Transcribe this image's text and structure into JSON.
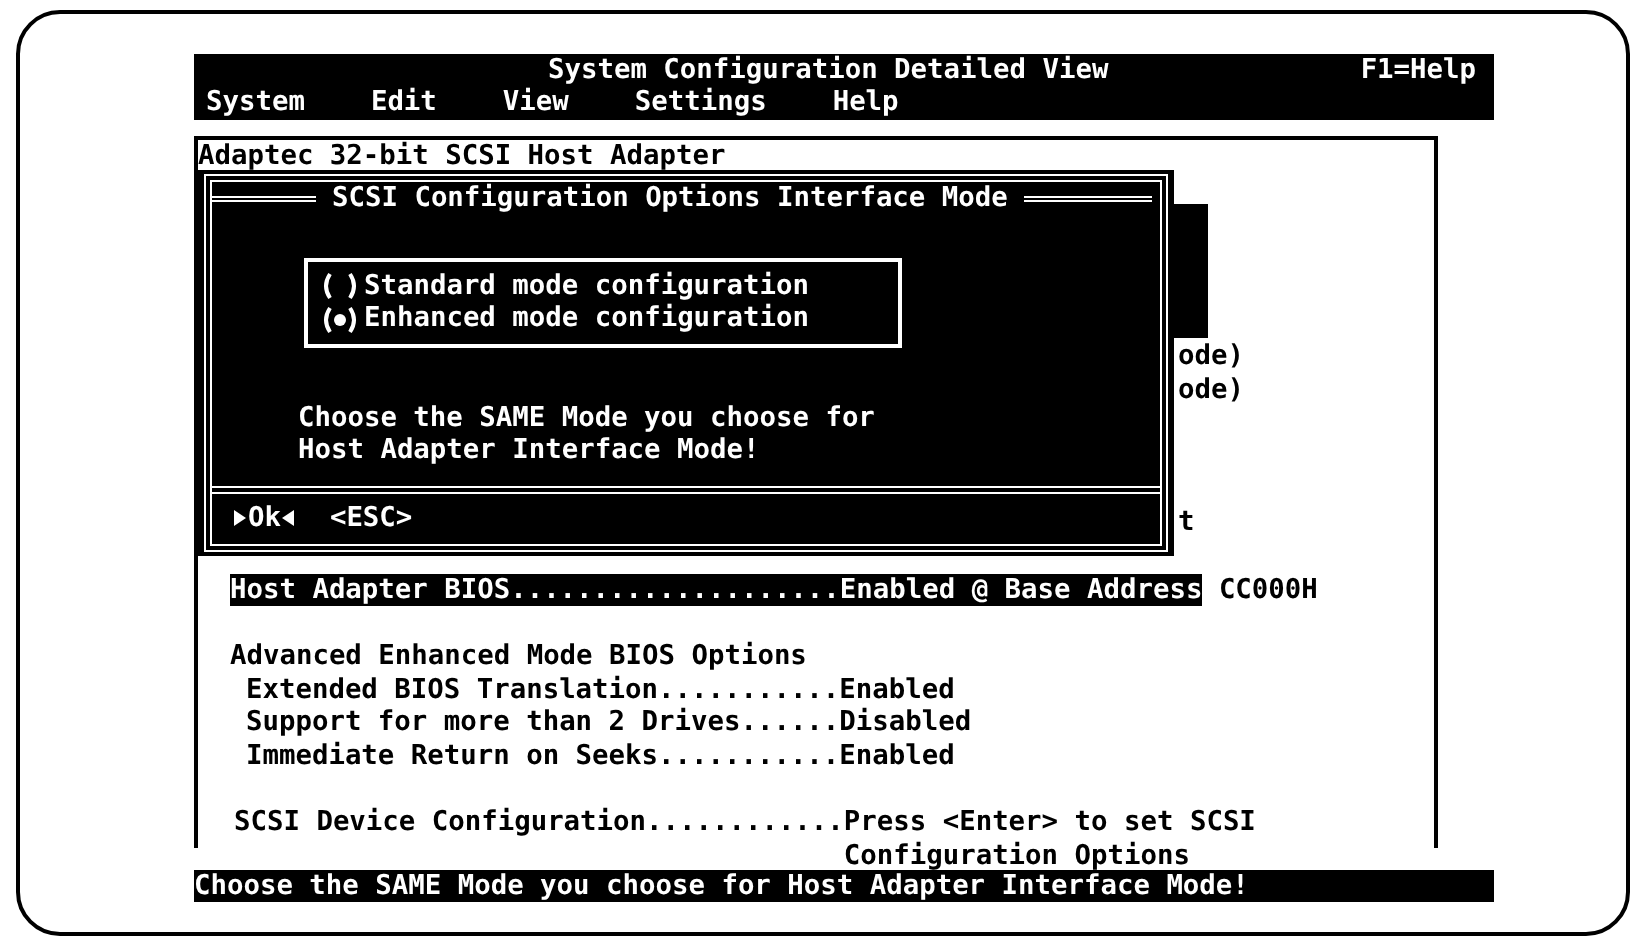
{
  "title_bar": {
    "title": "System Configuration Detailed View",
    "help": "F1=Help"
  },
  "menu": [
    "System",
    "Edit",
    "View",
    "Settings",
    "Help"
  ],
  "frame": {
    "title": "Adaptec 32-bit SCSI Host Adapter"
  },
  "obscured_fragments": [
    "ode)",
    "ode)",
    "t"
  ],
  "dialog": {
    "title": "SCSI Configuration Options Interface Mode",
    "options": [
      {
        "label": "Standard mode configuration",
        "selected": false
      },
      {
        "label": "Enhanced mode configuration",
        "selected": true
      }
    ],
    "message": "Choose the SAME Mode you choose for Host Adapter Interface Mode!",
    "buttons": [
      {
        "label": "Ok",
        "focused": true
      },
      {
        "label": "<ESC>",
        "focused": false
      }
    ]
  },
  "bios_row": {
    "label": "Host Adapter BIOS....................",
    "value": "Enabled @ Base Address",
    "address": "CC000H",
    "selected": true
  },
  "advanced": {
    "heading": "Advanced Enhanced Mode BIOS Options",
    "options": [
      {
        "label": "Extended BIOS Translation...........",
        "value": "Enabled"
      },
      {
        "label": "Support for more than 2 Drives......",
        "value": "Disabled"
      },
      {
        "label": "Immediate Return on Seeks...........",
        "value": "Enabled"
      }
    ]
  },
  "scsi_device": {
    "label": "SCSI Device Configuration............",
    "value": "Press <Enter> to set SCSI Configuration Options"
  },
  "status_bar": "Choose the SAME Mode you choose for Host Adapter Interface Mode!"
}
